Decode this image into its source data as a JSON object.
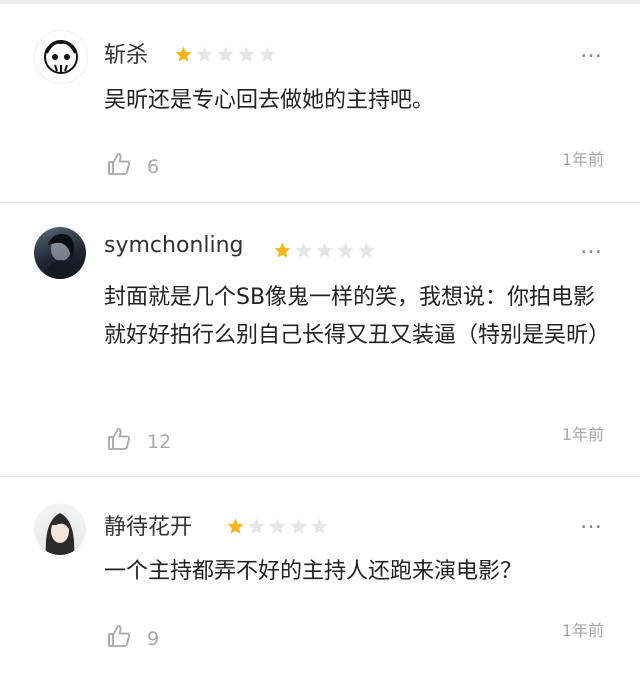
{
  "colors": {
    "star_filled": "#f5b61a",
    "star_empty": "#e6e6e6",
    "muted": "#a8a8a8",
    "divider": "#e6e6e6"
  },
  "reviews": [
    {
      "username": "斩杀",
      "rating": 1,
      "more_icon": "…",
      "text": "吴昕还是专心回去做她的主持吧。",
      "likes": "6",
      "time": "1年前"
    },
    {
      "username": "symchonling",
      "rating": 1,
      "more_icon": "…",
      "text": "封面就是几个SB像鬼一样的笑，我想说：你拍电影就好好拍行么别自己长得又丑又装逼（特别是吴昕）",
      "likes": "12",
      "time": "1年前"
    },
    {
      "username": "静待花开",
      "rating": 1,
      "more_icon": "…",
      "text": "一个主持都弄不好的主持人还跑来演电影？",
      "likes": "9",
      "time": "1年前"
    }
  ]
}
